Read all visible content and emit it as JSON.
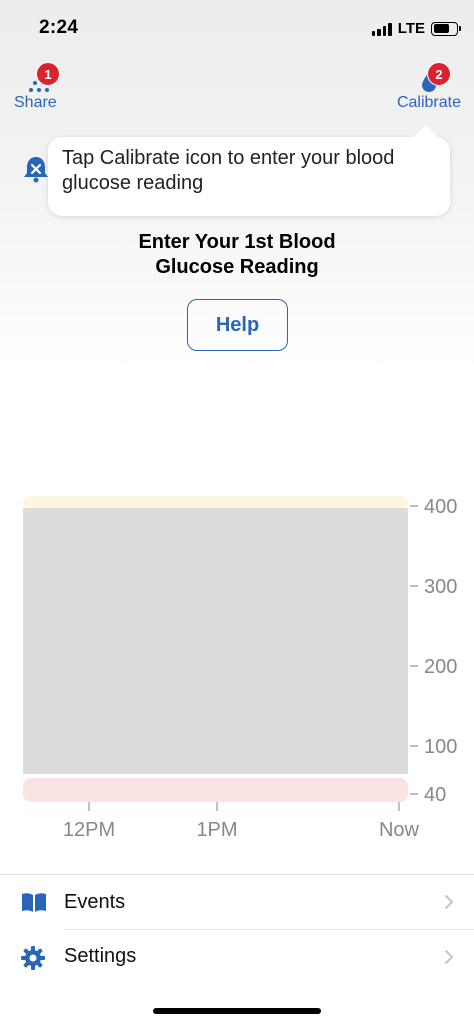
{
  "status_bar": {
    "time": "2:24",
    "network": "LTE",
    "battery_icon": "battery-icon",
    "signal_icon": "cellular-signal-icon"
  },
  "actions": {
    "share": {
      "label": "Share",
      "badge": "1",
      "icon": "share-dots-icon"
    },
    "calibrate": {
      "label": "Calibrate",
      "badge": "2",
      "icon": "blood-drop-icon"
    }
  },
  "alert_icon": "alert-bell-icon",
  "tooltip": {
    "text": "Tap Calibrate icon to enter your blood glucose reading"
  },
  "prompt": {
    "line1": "Enter Your 1st Blood",
    "line2": "Glucose Reading"
  },
  "help_button": {
    "label": "Help"
  },
  "chart_data": {
    "type": "area",
    "y_ticks": [
      400,
      300,
      200,
      100,
      40
    ],
    "x_ticks": [
      "12PM",
      "1PM",
      "Now"
    ],
    "ylim": [
      40,
      400
    ],
    "high_range_color": "#fdf6df",
    "low_range_color": "#fbe3e3",
    "no_data_color": "#dcdcdc",
    "series": []
  },
  "menu": [
    {
      "label": "Events",
      "icon": "book-icon"
    },
    {
      "label": "Settings",
      "icon": "gear-icon"
    }
  ],
  "colors": {
    "accent": "#2a66b8",
    "badge": "#d9232e"
  }
}
